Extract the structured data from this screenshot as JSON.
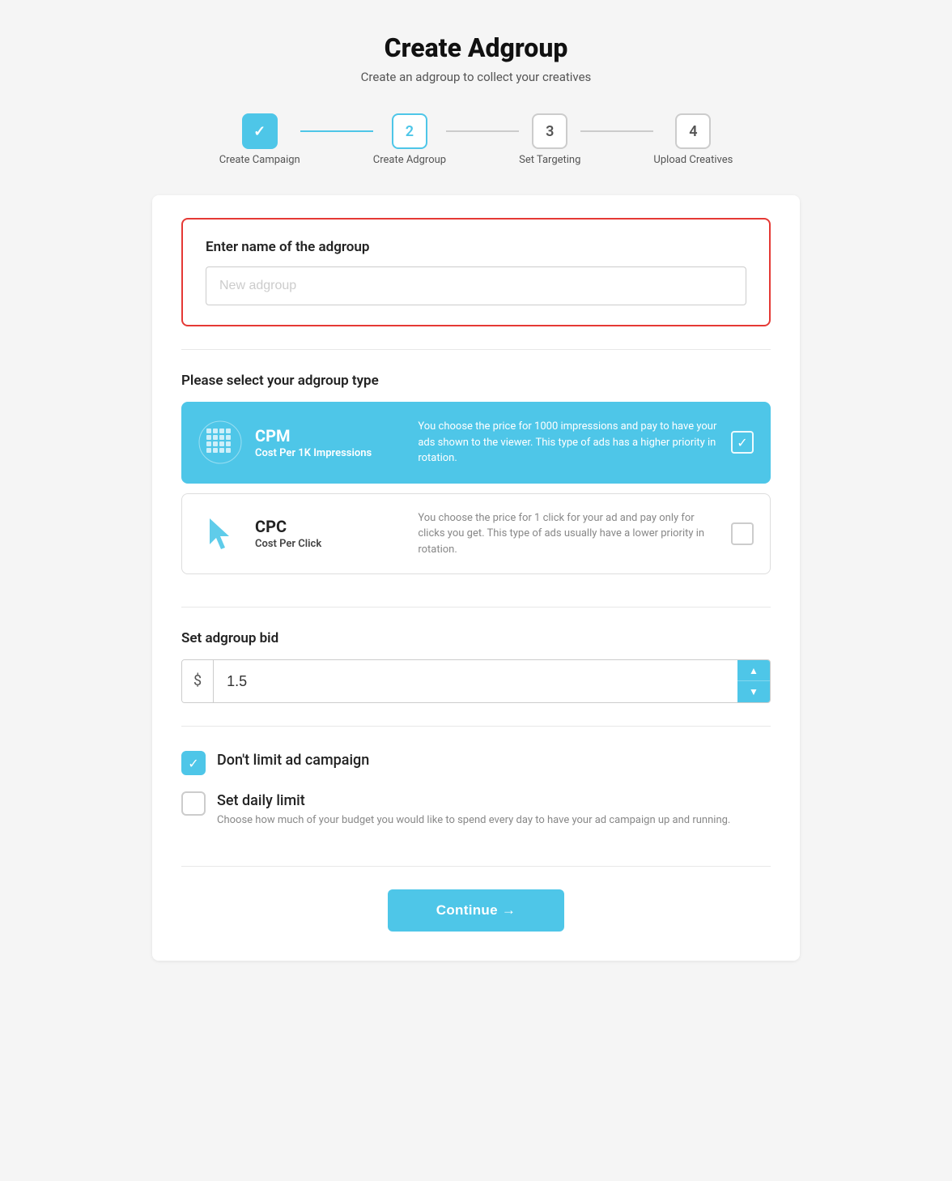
{
  "page": {
    "title": "Create Adgroup",
    "subtitle": "Create an adgroup to collect your creatives"
  },
  "stepper": {
    "steps": [
      {
        "label": "Create Campaign",
        "number": "1",
        "state": "completed"
      },
      {
        "label": "Create Adgroup",
        "number": "2",
        "state": "active"
      },
      {
        "label": "Set Targeting",
        "number": "3",
        "state": "inactive"
      },
      {
        "label": "Upload Creatives",
        "number": "4",
        "state": "inactive"
      }
    ]
  },
  "name_section": {
    "label": "Enter name of the adgroup",
    "placeholder": "New adgroup"
  },
  "adgroup_type": {
    "title": "Please select your adgroup type",
    "options": [
      {
        "name": "CPM",
        "sub": "Cost Per 1K Impressions",
        "desc": "You choose the price for 1000 impressions and pay to have your ads shown to the viewer. This type of ads has a higher priority in rotation.",
        "selected": true
      },
      {
        "name": "CPC",
        "sub": "Cost Per Click",
        "desc": "You choose the price for 1 click for your ad and pay only for clicks you get. This type of ads usually have a lower priority in rotation.",
        "selected": false
      }
    ]
  },
  "bid": {
    "title": "Set adgroup bid",
    "currency": "$",
    "value": "1.5",
    "up_arrow": "▲",
    "down_arrow": "▼"
  },
  "limits": {
    "options": [
      {
        "label": "Don't limit ad campaign",
        "desc": "",
        "checked": true
      },
      {
        "label": "Set daily limit",
        "desc": "Choose how much of your budget you would like to spend every day to have your ad campaign up and running.",
        "checked": false
      }
    ]
  },
  "continue": {
    "label": "Continue →"
  }
}
